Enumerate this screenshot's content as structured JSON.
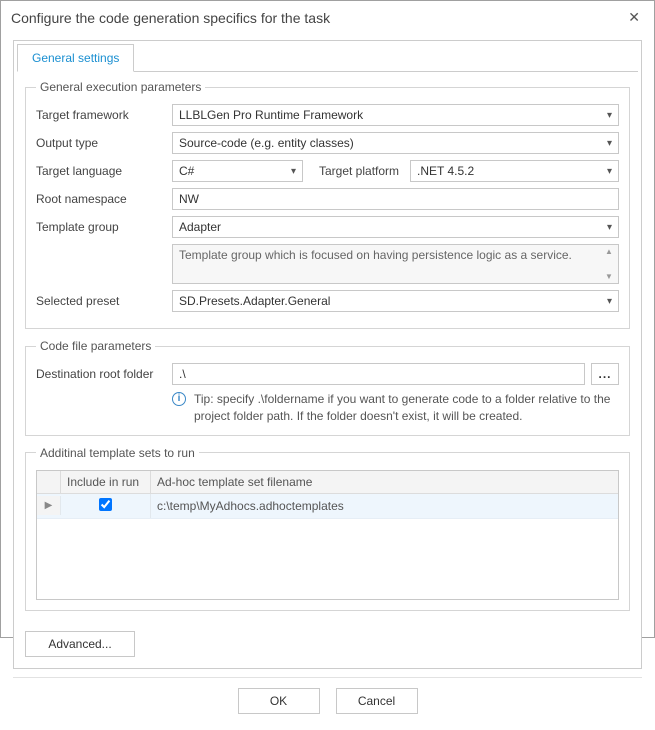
{
  "dialog": {
    "title": "Configure the code generation specifics for the task"
  },
  "tabs": {
    "general": "General settings"
  },
  "groups": {
    "exec": "General execution parameters",
    "codefile": "Code file parameters",
    "templates": "Additinal template sets to run"
  },
  "labels": {
    "target_framework": "Target framework",
    "output_type": "Output type",
    "target_language": "Target language",
    "target_platform": "Target platform",
    "root_namespace": "Root namespace",
    "template_group": "Template group",
    "selected_preset": "Selected preset",
    "dest_root": "Destination root folder"
  },
  "values": {
    "target_framework": "LLBLGen Pro Runtime Framework",
    "output_type": "Source-code (e.g. entity classes)",
    "target_language": "C#",
    "target_platform": ".NET 4.5.2",
    "root_namespace": "NW",
    "template_group": "Adapter",
    "template_group_desc": "Template group which is focused on having persistence logic as a service.",
    "selected_preset": "SD.Presets.Adapter.General",
    "dest_root": ".\\",
    "dest_tip": "Tip: specify .\\foldername if you want to generate code to a folder relative to the project folder path. If the folder doesn't exist, it will be created."
  },
  "grid": {
    "col_include": "Include in run",
    "col_filename": "Ad-hoc template set filename",
    "rows": [
      {
        "included": true,
        "filename": "c:\\temp\\MyAdhocs.adhoctemplates"
      }
    ]
  },
  "buttons": {
    "advanced": "Advanced...",
    "ok": "OK",
    "cancel": "Cancel",
    "browse": "..."
  }
}
